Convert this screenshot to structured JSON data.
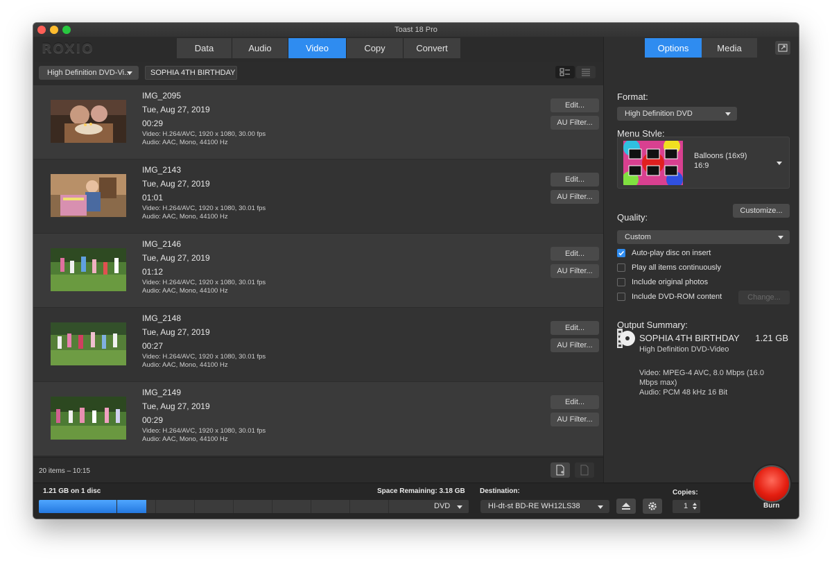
{
  "window": {
    "title": "Toast 18 Pro"
  },
  "logo": "ROXIO",
  "main_tabs": [
    {
      "label": "Data",
      "active": false
    },
    {
      "label": "Audio",
      "active": false
    },
    {
      "label": "Video",
      "active": true
    },
    {
      "label": "Copy",
      "active": false
    },
    {
      "label": "Convert",
      "active": false
    }
  ],
  "side_tabs": [
    {
      "label": "Options",
      "active": true
    },
    {
      "label": "Media",
      "active": false
    }
  ],
  "project": {
    "format_select": "High Definition DVD-Vi...",
    "name": "SOPHIA 4TH BIRTHDAY"
  },
  "items": [
    {
      "name": "IMG_2095",
      "date": "Tue, Aug 27, 2019",
      "duration": "00:29",
      "video": "Video: H.264/AVC, 1920 x 1080, 30.00 fps",
      "audio": "Audio: AAC, Mono, 44100 Hz"
    },
    {
      "name": "IMG_2143",
      "date": "Tue, Aug 27, 2019",
      "duration": "01:01",
      "video": "Video: H.264/AVC, 1920 x 1080, 30.01 fps",
      "audio": "Audio: AAC, Mono, 44100 Hz"
    },
    {
      "name": "IMG_2146",
      "date": "Tue, Aug 27, 2019",
      "duration": "01:12",
      "video": "Video: H.264/AVC, 1920 x 1080, 30.01 fps",
      "audio": "Audio: AAC, Mono, 44100 Hz"
    },
    {
      "name": "IMG_2148",
      "date": "Tue, Aug 27, 2019",
      "duration": "00:27",
      "video": "Video: H.264/AVC, 1920 x 1080, 30.01 fps",
      "audio": "Audio: AAC, Mono, 44100 Hz"
    },
    {
      "name": "IMG_2149",
      "date": "Tue, Aug 27, 2019",
      "duration": "00:29",
      "video": "Video: H.264/AVC, 1920 x 1080, 30.01 fps",
      "audio": "Audio: AAC, Mono, 44100 Hz"
    }
  ],
  "row_buttons": {
    "edit": "Edit...",
    "au_filter": "AU Filter..."
  },
  "list_footer": {
    "item_count": "20 items – 10:15"
  },
  "options": {
    "format_label": "Format:",
    "format_value": "High Definition DVD",
    "menu_style_label": "Menu Style:",
    "menu_style_name": "Balloons (16x9)",
    "menu_style_ratio": "16:9",
    "customize": "Customize...",
    "quality_label": "Quality:",
    "quality_value": "Custom",
    "checkboxes": [
      {
        "label": "Auto-play disc on insert",
        "checked": true
      },
      {
        "label": "Play all items continuously",
        "checked": false
      },
      {
        "label": "Include original photos",
        "checked": false
      },
      {
        "label": "Include DVD-ROM content",
        "checked": false
      }
    ],
    "change": "Change..."
  },
  "output_summary": {
    "label": "Output Summary:",
    "title": "SOPHIA 4TH BIRTHDAY",
    "size": "1.21 GB",
    "format": "High Definition DVD-Video",
    "details": "Video: MPEG-4 AVC, 8.0 Mbps (16.0 Mbps max)\nAudio: PCM 48 kHz 16 Bit"
  },
  "bottom": {
    "used": "1.21 GB on 1 disc",
    "space_remaining": "Space Remaining: 3.18 GB",
    "capacity_used_fraction": 0.276,
    "disc_type": "DVD",
    "destination_label": "Destination:",
    "destination_value": "HI-dt-st BD-RE  WH12LS38",
    "copies_label": "Copies:",
    "copies_value": "1",
    "burn_label": "Burn"
  },
  "colors": {
    "accent": "#2f8cf0",
    "burn": "#e41e10"
  }
}
